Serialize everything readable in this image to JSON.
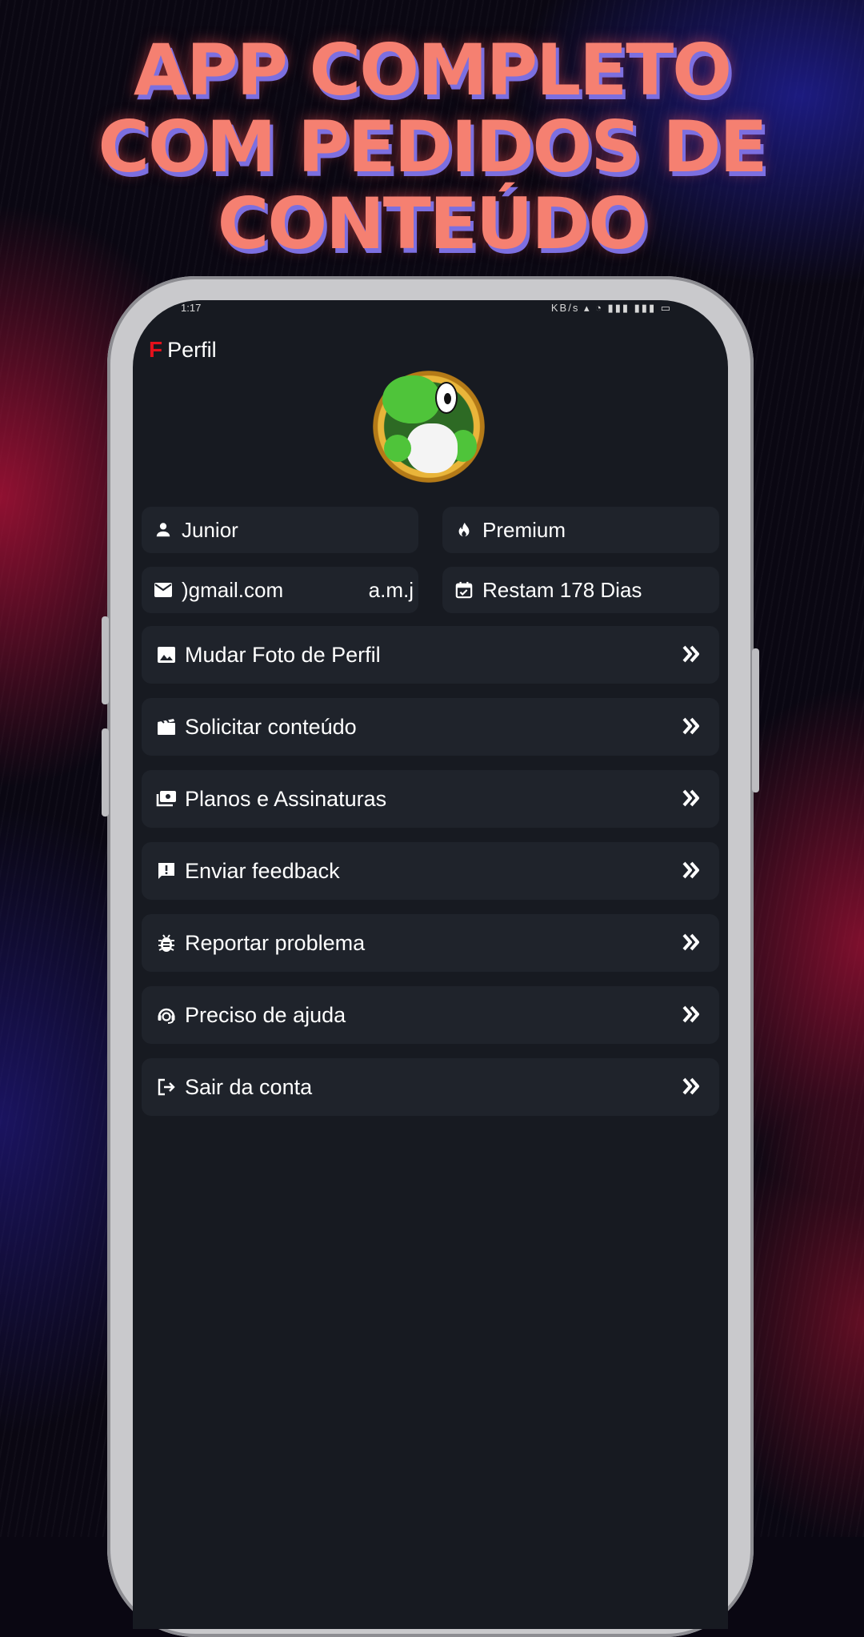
{
  "promo": {
    "line1": "APP COMPLETO",
    "line2": "COM PEDIDOS DE",
    "line3": "CONTEÚDO"
  },
  "statusbar": {
    "left": "1:17",
    "right": "KB/s"
  },
  "header": {
    "brand": "F",
    "title": "Perfil"
  },
  "profile": {
    "username": "Junior",
    "plan": "Premium",
    "email_start": ")gmail.com",
    "email_end": "a.m.j",
    "remaining": "Restam 178 Dias"
  },
  "menu": {
    "items": [
      {
        "label": "Mudar Foto de Perfil",
        "icon": "image-icon"
      },
      {
        "label": "Solicitar conteúdo",
        "icon": "movie-icon"
      },
      {
        "label": "Planos e Assinaturas",
        "icon": "payments-icon"
      },
      {
        "label": "Enviar feedback",
        "icon": "feedback-icon"
      },
      {
        "label": "Reportar problema",
        "icon": "bug-icon"
      },
      {
        "label": "Preciso de ajuda",
        "icon": "support-agent-icon"
      },
      {
        "label": "Sair da conta",
        "icon": "logout-icon"
      }
    ]
  },
  "colors": {
    "screen_bg": "#171a21",
    "card_bg": "#1f232b",
    "brand_red": "#e3111b",
    "headline": "#f58071",
    "headline_shadow": "#7c6fe0"
  }
}
